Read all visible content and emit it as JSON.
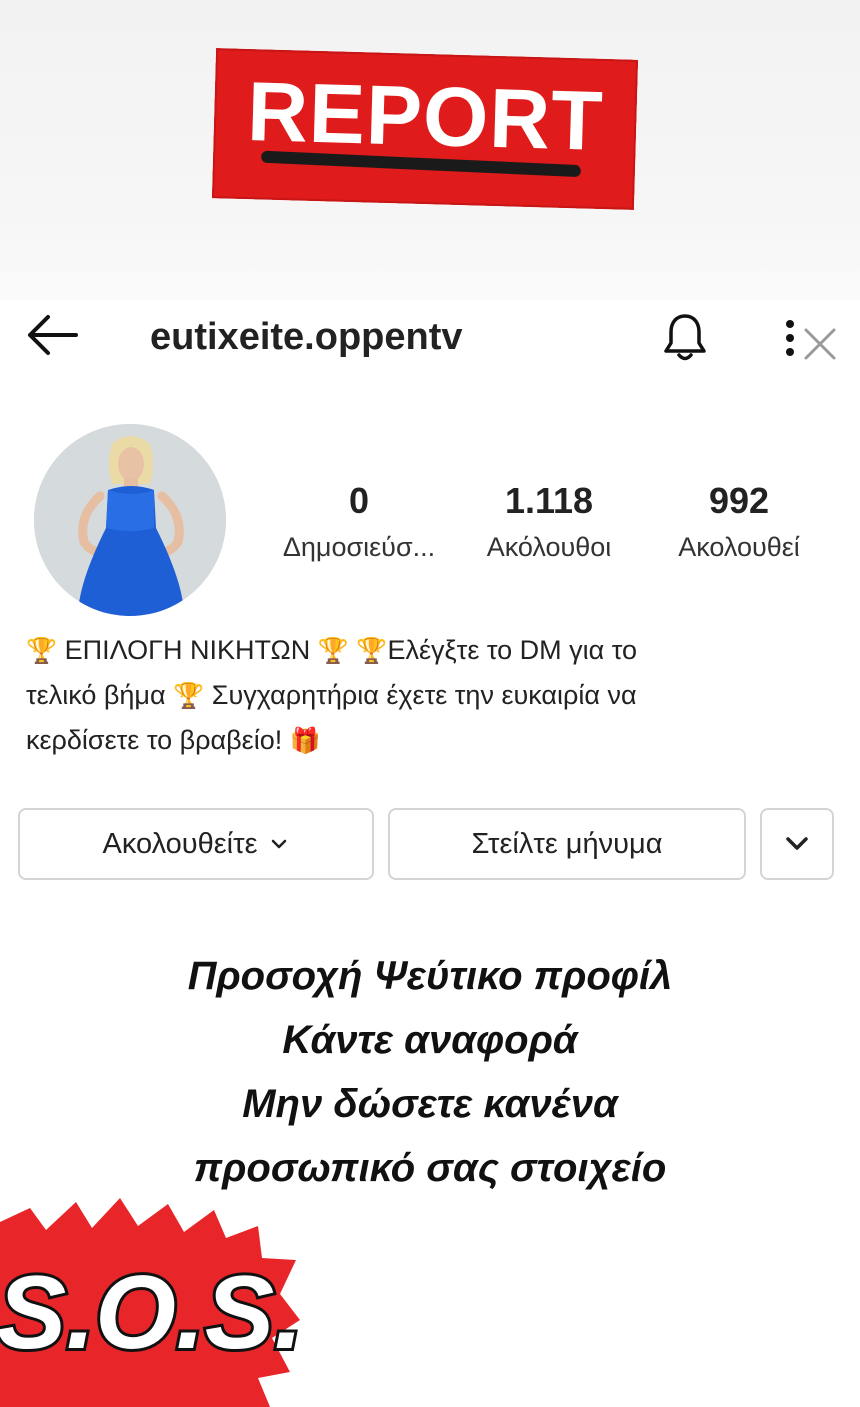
{
  "overlay": {
    "report_label": "REPORT",
    "report_color": "#e01b1b",
    "sos_label": "S.O.S.",
    "sos_color": "#e8262a"
  },
  "header": {
    "username": "eutixeite.oppentv",
    "icons": [
      "back-arrow-icon",
      "bell-icon",
      "more-icon",
      "close-icon"
    ]
  },
  "profile": {
    "stats": [
      {
        "value": "0",
        "label": "Δημοσιεύσ..."
      },
      {
        "value": "1.118",
        "label": "Ακόλουθοι"
      },
      {
        "value": "992",
        "label": "Ακολουθεί"
      }
    ],
    "bio": {
      "line1": "ΕΠΙΛΟΓΗ ΝΙΚΗΤΩΝ",
      "line2": "Ελέγξτε το DM για το",
      "line3": "τελικό βήμα",
      "line4": "Συγχαρητήρια έχετε την ευκαιρία να",
      "line5": "κερδίσετε το βραβείο!",
      "trophy": "🏆",
      "gift": "🎁"
    }
  },
  "actions": {
    "follow_label": "Ακολουθείτε",
    "message_label": "Στείλτε μήνυμα"
  },
  "warning": {
    "lines": [
      "Προσοχή Ψεύτικο προφίλ",
      "Κάντε αναφορά",
      "Μην δώσετε κανένα",
      "προσωπικό σας στοιχείο"
    ]
  }
}
